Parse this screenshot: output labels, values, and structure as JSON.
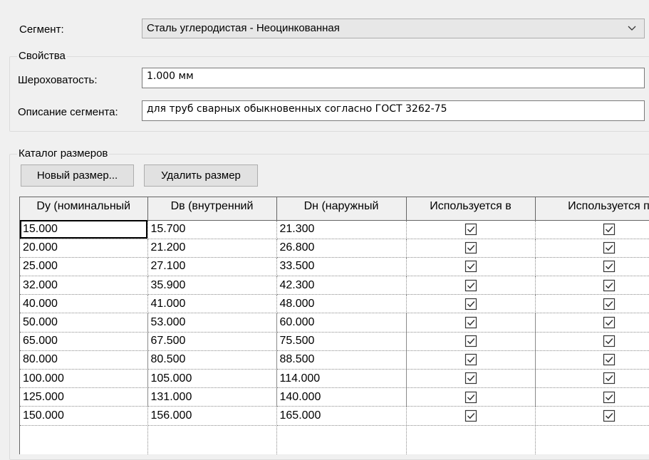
{
  "segment": {
    "label": "Сегмент:",
    "value": "Сталь углеродистая - Неоцинкованная",
    "dropdown_icon": "chevron-down-icon"
  },
  "properties": {
    "title": "Свойства",
    "roughness_label": "Шероховатость:",
    "roughness_value": "1.000 мм",
    "description_label": "Описание сегмента:",
    "description_value": "для труб сварных обыкновенных согласно ГОСТ 3262-75"
  },
  "catalog": {
    "title": "Каталог размеров",
    "new_button": "Новый размер...",
    "delete_button": "Удалить размер",
    "columns": [
      "Dу (номинальный",
      "Dв (внутренний",
      "Dн (наружный",
      "Используется в",
      "Используется п"
    ],
    "rows": [
      [
        "15.000",
        "15.700",
        "21.300",
        true,
        true
      ],
      [
        "20.000",
        "21.200",
        "26.800",
        true,
        true
      ],
      [
        "25.000",
        "27.100",
        "33.500",
        true,
        true
      ],
      [
        "32.000",
        "35.900",
        "42.300",
        true,
        true
      ],
      [
        "40.000",
        "41.000",
        "48.000",
        true,
        true
      ],
      [
        "50.000",
        "53.000",
        "60.000",
        true,
        true
      ],
      [
        "65.000",
        "67.500",
        "75.500",
        true,
        true
      ],
      [
        "80.000",
        "80.500",
        "88.500",
        true,
        true
      ],
      [
        "100.000",
        "105.000",
        "114.000",
        true,
        true
      ],
      [
        "125.000",
        "131.000",
        "140.000",
        true,
        true
      ],
      [
        "150.000",
        "156.000",
        "165.000",
        true,
        true
      ]
    ]
  }
}
